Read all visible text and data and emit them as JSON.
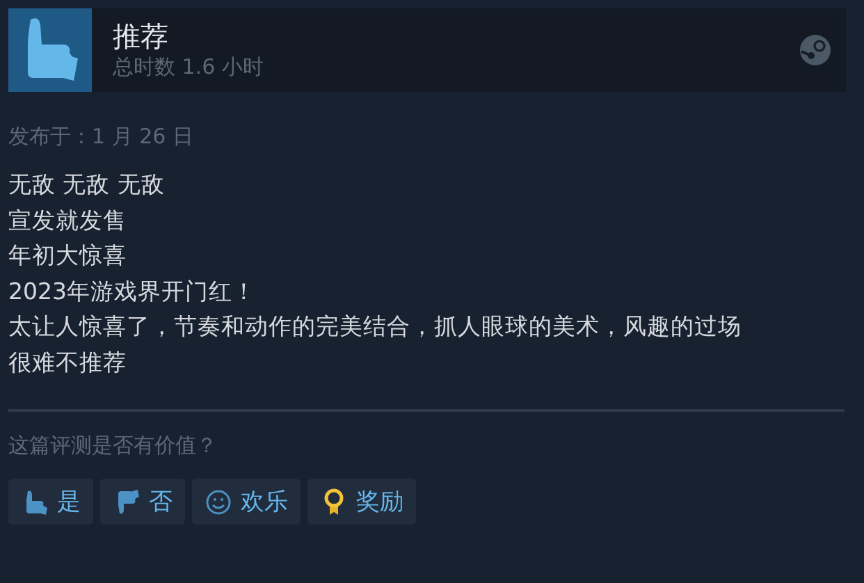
{
  "header": {
    "title": "推荐",
    "playtime": "总时数 1.6 小时"
  },
  "posted": "发布于：1 月 26 日",
  "review_lines": [
    "无敌 无敌 无敌",
    "宣发就发售",
    "年初大惊喜",
    "2023年游戏界开门红！",
    "太让人惊喜了，节奏和动作的完美结合，抓人眼球的美术，风趣的过场",
    "很难不推荐"
  ],
  "helpful_question": "这篇评测是否有价值？",
  "buttons": [
    {
      "kind": "up",
      "label": "是"
    },
    {
      "kind": "down",
      "label": "否"
    },
    {
      "kind": "smile",
      "label": "欢乐"
    },
    {
      "kind": "award",
      "label": "奖励"
    }
  ]
}
